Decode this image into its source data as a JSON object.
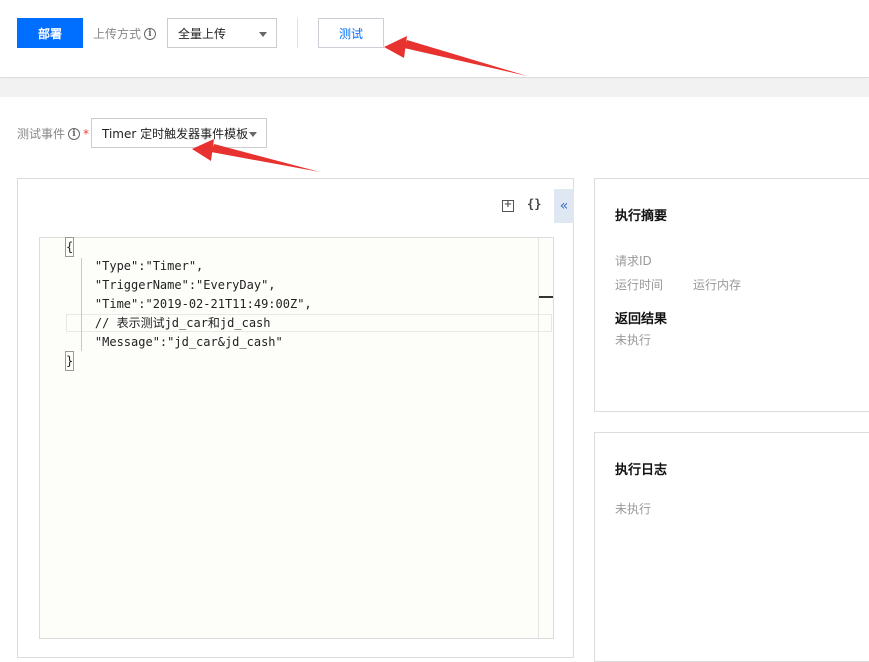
{
  "toolbar": {
    "deploy_label": "部署",
    "upload_mode_label": "上传方式",
    "upload_mode_value": "全量上传",
    "test_label": "测试"
  },
  "test_event": {
    "label": "测试事件",
    "required_mark": "*",
    "selected_template": "Timer 定时触发器事件模板"
  },
  "editor": {
    "lines": [
      "{",
      "    \"Type\":\"Timer\",",
      "    \"TriggerName\":\"EveryDay\",",
      "    \"Time\":\"2019-02-21T11:49:00Z\",",
      "    // 表示测试jd_car和jd_cash",
      "    \"Message\":\"jd_car&jd_cash\"",
      "}"
    ],
    "icons": [
      "new-file-icon",
      "format-braces-icon",
      "collapse-left-icon"
    ]
  },
  "summary": {
    "title": "执行摘要",
    "request_id_label": "请求ID",
    "run_time_label": "运行时间",
    "run_memory_label": "运行内存",
    "result_title": "返回结果",
    "result_value": "未执行"
  },
  "log": {
    "title": "执行日志",
    "value": "未执行"
  },
  "colors": {
    "primary": "#006eff",
    "annotation_arrow": "#e8322f"
  }
}
